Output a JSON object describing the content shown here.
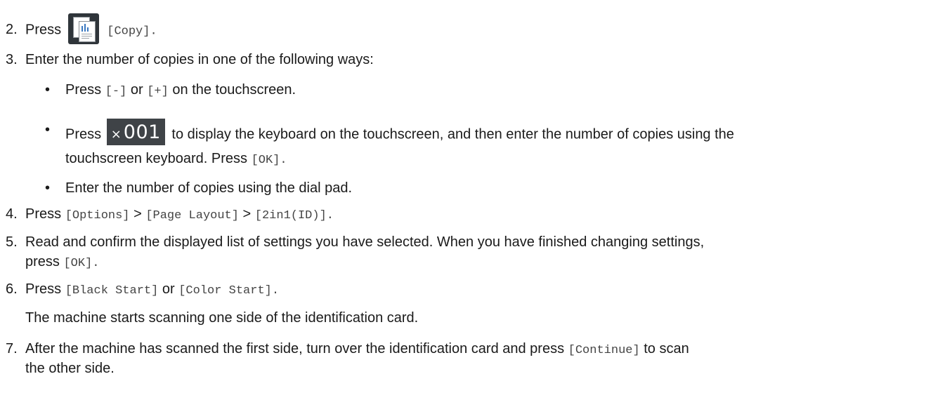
{
  "steps": {
    "s2": {
      "number": "2.",
      "press": "Press",
      "icon": "copy-icon",
      "label": "[Copy]."
    },
    "s3": {
      "number": "3.",
      "text": "Enter the number of copies in one of the following ways:",
      "bullets": {
        "b1": {
          "symbol": "•",
          "press": "Press",
          "minus": "[-]",
          "or": "or",
          "plus": "[+]",
          "rest": "on the touchscreen."
        },
        "b2": {
          "symbol": "•",
          "press": "Press",
          "counter_x": "×",
          "counter_value": "001",
          "rest_line1": "to display the keyboard on the touchscreen, and then enter the number of copies using the",
          "rest_line2": "touchscreen keyboard. Press",
          "ok": "[OK]."
        },
        "b3": {
          "symbol": "•",
          "text": "Enter the number of copies using the dial pad."
        }
      }
    },
    "s4": {
      "number": "4.",
      "press": "Press",
      "options": "[Options]",
      "sep1": ">",
      "page_layout": "[Page Layout]",
      "sep2": ">",
      "id": "[2in1(ID)]."
    },
    "s5": {
      "number": "5.",
      "line1": "Read and confirm the displayed list of settings you have selected. When you have finished changing settings,",
      "line2": "press",
      "ok": "[OK]."
    },
    "s6": {
      "number": "6.",
      "press": "Press",
      "black": "[Black Start]",
      "or": "or",
      "color": "[Color Start].",
      "note": "The machine starts scanning one side of the identification card."
    },
    "s7": {
      "number": "7.",
      "line1": "After the machine has scanned the first side, turn over the identification card and press",
      "continue": "[Continue]",
      "line1_end": "to scan",
      "line2": "the other side."
    }
  }
}
